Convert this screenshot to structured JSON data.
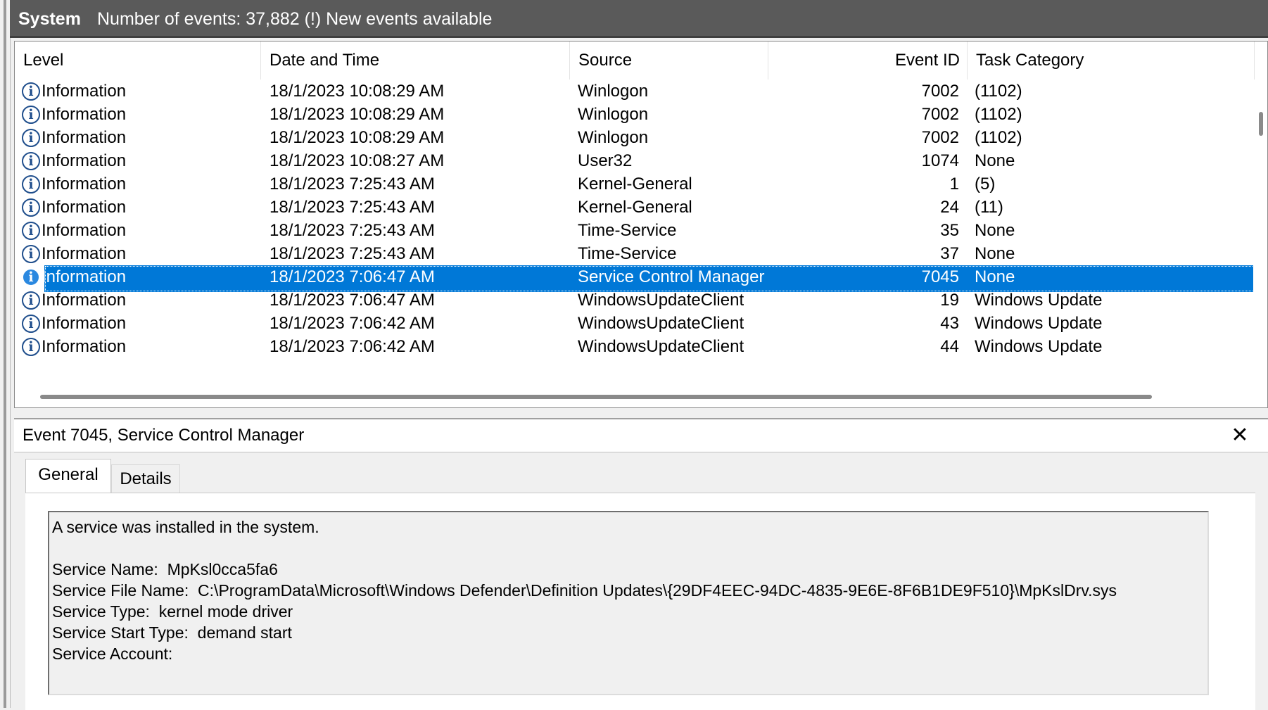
{
  "title_bar": {
    "log_name": "System",
    "info": "Number of events: 37,882 (!) New events available"
  },
  "columns": {
    "level": "Level",
    "datetime": "Date and Time",
    "source": "Source",
    "event_id": "Event ID",
    "task_category": "Task Category"
  },
  "rows": [
    {
      "level": "Information",
      "datetime": "18/1/2023 10:08:29 AM",
      "source": "Winlogon",
      "event_id": "7002",
      "task_category": "(1102)",
      "selected": false
    },
    {
      "level": "Information",
      "datetime": "18/1/2023 10:08:29 AM",
      "source": "Winlogon",
      "event_id": "7002",
      "task_category": "(1102)",
      "selected": false
    },
    {
      "level": "Information",
      "datetime": "18/1/2023 10:08:29 AM",
      "source": "Winlogon",
      "event_id": "7002",
      "task_category": "(1102)",
      "selected": false
    },
    {
      "level": "Information",
      "datetime": "18/1/2023 10:08:27 AM",
      "source": "User32",
      "event_id": "1074",
      "task_category": "None",
      "selected": false
    },
    {
      "level": "Information",
      "datetime": "18/1/2023 7:25:43 AM",
      "source": "Kernel-General",
      "event_id": "1",
      "task_category": "(5)",
      "selected": false
    },
    {
      "level": "Information",
      "datetime": "18/1/2023 7:25:43 AM",
      "source": "Kernel-General",
      "event_id": "24",
      "task_category": "(11)",
      "selected": false
    },
    {
      "level": "Information",
      "datetime": "18/1/2023 7:25:43 AM",
      "source": "Time-Service",
      "event_id": "35",
      "task_category": "None",
      "selected": false
    },
    {
      "level": "Information",
      "datetime": "18/1/2023 7:25:43 AM",
      "source": "Time-Service",
      "event_id": "37",
      "task_category": "None",
      "selected": false
    },
    {
      "level": "Information",
      "datetime": "18/1/2023 7:06:47 AM",
      "source": "Service Control Manager",
      "event_id": "7045",
      "task_category": "None",
      "selected": true
    },
    {
      "level": "Information",
      "datetime": "18/1/2023 7:06:47 AM",
      "source": "WindowsUpdateClient",
      "event_id": "19",
      "task_category": "Windows Update",
      "selected": false
    },
    {
      "level": "Information",
      "datetime": "18/1/2023 7:06:42 AM",
      "source": "WindowsUpdateClient",
      "event_id": "43",
      "task_category": "Windows Update",
      "selected": false
    },
    {
      "level": "Information",
      "datetime": "18/1/2023 7:06:42 AM",
      "source": "WindowsUpdateClient",
      "event_id": "44",
      "task_category": "Windows Update",
      "selected": false
    }
  ],
  "detail": {
    "header_title": "Event 7045, Service Control Manager",
    "close_glyph": "✕",
    "tabs": [
      "General",
      "Details"
    ],
    "active_tab": "General",
    "description": "A service was installed in the system.\n\nService Name:  MpKsl0cca5fa6\nService File Name:  C:\\ProgramData\\Microsoft\\Windows Defender\\Definition Updates\\{29DF4EEC-94DC-4835-9E6E-8F6B1DE9F510}\\MpKslDrv.sys\nService Type:  kernel mode driver\nService Start Type:  demand start\nService Account:"
  },
  "icons": {
    "info_glyph": "i"
  },
  "colors": {
    "title_bar": "#5a5a5a",
    "selection": "#0078d7",
    "info_icon": "#1f4e8c"
  }
}
